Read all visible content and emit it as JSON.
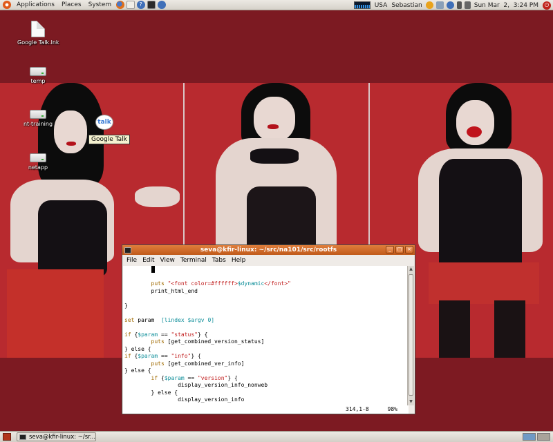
{
  "top_panel": {
    "menus": [
      "Applications",
      "Places",
      "System"
    ],
    "launchers": [
      {
        "icon": "firefox-icon",
        "color": "#e0701a"
      },
      {
        "icon": "mail-icon",
        "color": "#f0eee8"
      },
      {
        "icon": "help-icon",
        "color": "#3f6fb8"
      },
      {
        "icon": "terminal-icon",
        "color": "#2b2b2b"
      },
      {
        "icon": "update-icon",
        "color": "#3f6fb8"
      }
    ],
    "keyboard_layout": "USA",
    "user": "Sebastian",
    "clock": "Sun Mar  2,  3:24 PM"
  },
  "desktop": {
    "icons": [
      {
        "label": "Google Talk.lnk",
        "type": "document"
      },
      {
        "label": "temp",
        "type": "drive"
      },
      {
        "label": "nt-training",
        "type": "drive"
      },
      {
        "label": "netapp",
        "type": "drive"
      }
    ],
    "talk_bubble": "talk",
    "tooltip": "Google Talk"
  },
  "terminal": {
    "title": "seva@kfir-linux: ~/src/na101/src/rootfs",
    "menus": [
      "File",
      "Edit",
      "View",
      "Terminal",
      "Tabs",
      "Help"
    ],
    "code_lines": [
      [
        {
          "t": "        "
        },
        {
          "t": "cursor"
        }
      ],
      [
        {
          "t": ""
        }
      ],
      [
        {
          "t": "        "
        },
        {
          "t": "puts",
          "c": "kw"
        },
        {
          "t": " "
        },
        {
          "t": "\"<font color=#ffffff>",
          "c": "st"
        },
        {
          "t": "$dynamic",
          "c": "vr"
        },
        {
          "t": "</font>\"",
          "c": "st"
        }
      ],
      [
        {
          "t": "        print_html_end"
        }
      ],
      [
        {
          "t": ""
        }
      ],
      [
        {
          "t": "}"
        }
      ],
      [
        {
          "t": ""
        }
      ],
      [
        {
          "t": "set",
          "c": "kw"
        },
        {
          "t": " param  "
        },
        {
          "t": "[lindex",
          "c": "vr"
        },
        {
          "t": " "
        },
        {
          "t": "$argv",
          "c": "vr"
        },
        {
          "t": " "
        },
        {
          "t": "0]",
          "c": "vr"
        }
      ],
      [
        {
          "t": ""
        }
      ],
      [
        {
          "t": "if",
          "c": "kw"
        },
        {
          "t": " {"
        },
        {
          "t": "$param",
          "c": "vr"
        },
        {
          "t": " == "
        },
        {
          "t": "\"status\"",
          "c": "st"
        },
        {
          "t": "} {"
        }
      ],
      [
        {
          "t": "        "
        },
        {
          "t": "puts",
          "c": "kw"
        },
        {
          "t": " [get_combined_version_status]"
        }
      ],
      [
        {
          "t": "} else {"
        }
      ],
      [
        {
          "t": "if",
          "c": "kw"
        },
        {
          "t": " {"
        },
        {
          "t": "$param",
          "c": "vr"
        },
        {
          "t": " == "
        },
        {
          "t": "\"info\"",
          "c": "st"
        },
        {
          "t": "} {"
        }
      ],
      [
        {
          "t": "        "
        },
        {
          "t": "puts",
          "c": "kw"
        },
        {
          "t": " [get_combined_ver_info]"
        }
      ],
      [
        {
          "t": "} else {"
        }
      ],
      [
        {
          "t": "        "
        },
        {
          "t": "if",
          "c": "kw"
        },
        {
          "t": " {"
        },
        {
          "t": "$param",
          "c": "vr"
        },
        {
          "t": " == "
        },
        {
          "t": "\"version\"",
          "c": "st"
        },
        {
          "t": "} {"
        }
      ],
      [
        {
          "t": "                display_version_info_nonweb"
        }
      ],
      [
        {
          "t": "        } else {"
        }
      ],
      [
        {
          "t": "                display_version_info"
        }
      ]
    ],
    "cursor_position": "314,1-8",
    "scroll_percent": "98%"
  },
  "bottom_panel": {
    "task_label": "seva@kfir-linux: ~/sr..."
  }
}
